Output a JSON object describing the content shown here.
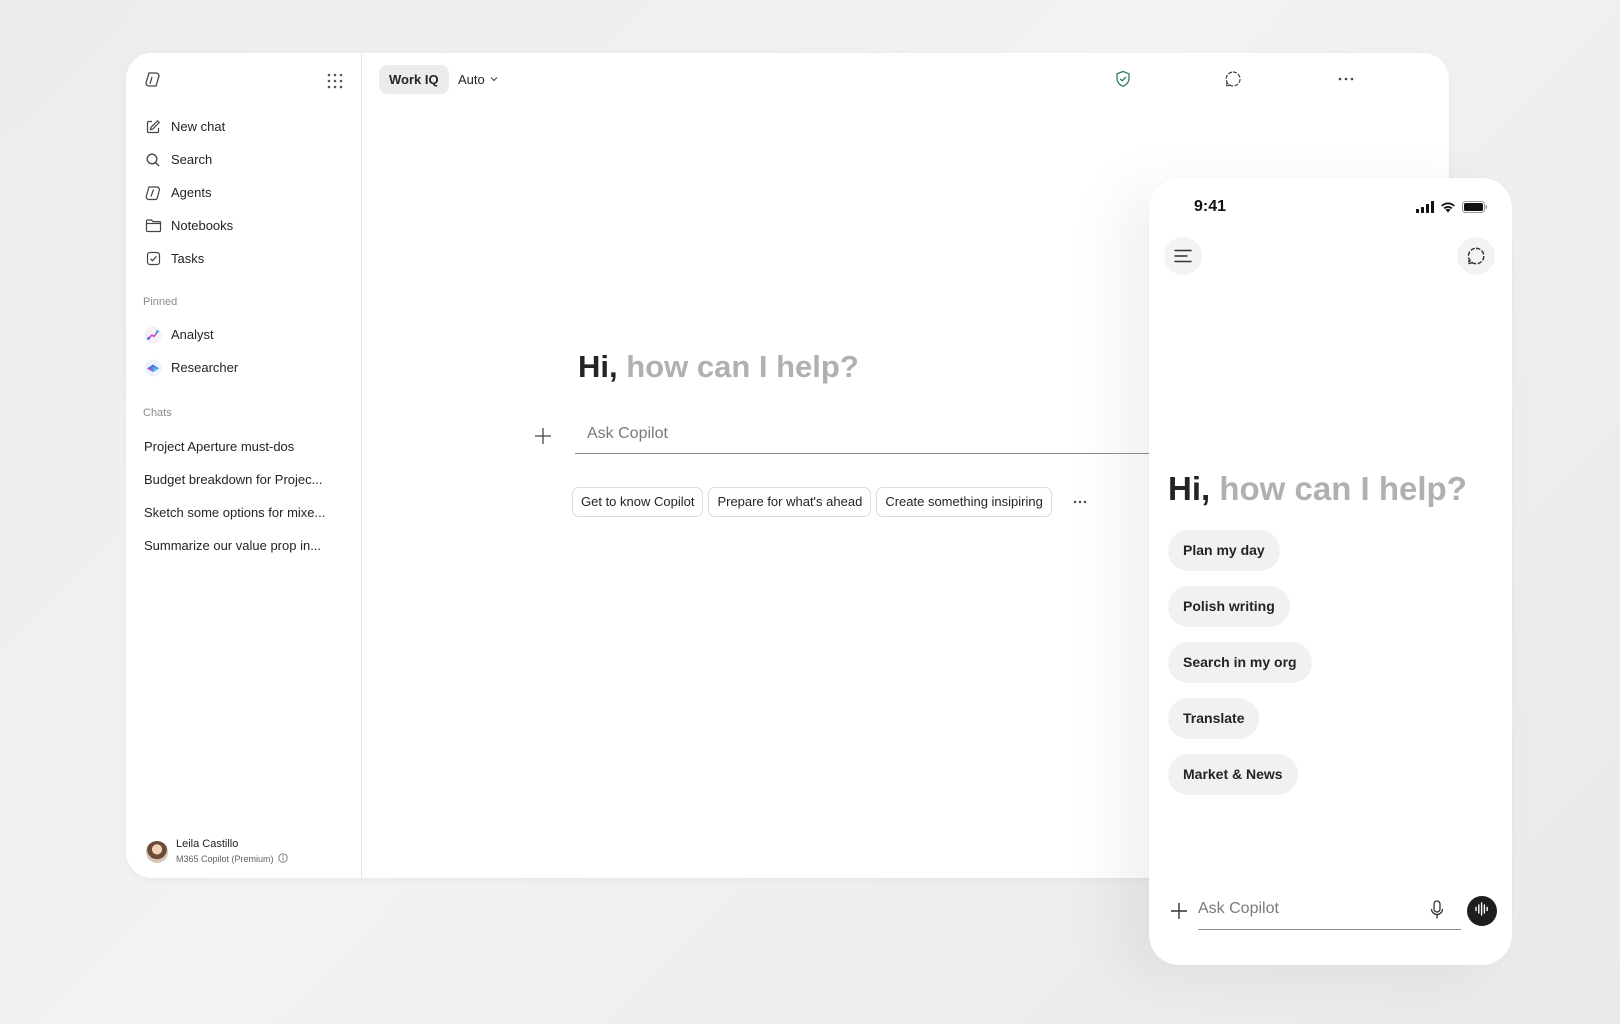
{
  "sidebar": {
    "nav": [
      {
        "label": "New chat",
        "icon": "compose-icon"
      },
      {
        "label": "Search",
        "icon": "search-icon"
      },
      {
        "label": "Agents",
        "icon": "agents-icon"
      },
      {
        "label": "Notebooks",
        "icon": "folder-icon"
      },
      {
        "label": "Tasks",
        "icon": "checkbox-icon"
      }
    ],
    "pinned_label": "Pinned",
    "pinned": [
      {
        "label": "Analyst",
        "icon": "analyst-icon"
      },
      {
        "label": "Researcher",
        "icon": "researcher-icon"
      }
    ],
    "chats_label": "Chats",
    "chats": [
      "Project Aperture must-dos",
      "Budget breakdown for Projec...",
      "Sketch some options for mixe...",
      "Summarize our value prop in..."
    ],
    "user": {
      "name": "Leila Castillo",
      "plan": "M365 Copilot (Premium)"
    }
  },
  "topbar": {
    "workiq_label": "Work IQ",
    "model_label": "Auto",
    "icons": [
      "shield-check-icon",
      "new-chat-bubble-icon",
      "more-icon"
    ]
  },
  "main": {
    "greeting_hi": "Hi,",
    "greeting_rest": "how can I help?",
    "input_placeholder": "Ask Copilot",
    "chips": [
      "Get to know Copilot",
      "Prepare for what's ahead",
      "Create something insipiring"
    ]
  },
  "phone": {
    "time": "9:41",
    "greeting_hi": "Hi,",
    "greeting_rest": "how can I help?",
    "suggestions": [
      "Plan my day",
      "Polish writing",
      "Search in my org",
      "Translate",
      "Market & News"
    ],
    "input_placeholder": "Ask Copilot"
  },
  "colors": {
    "accent_shield": "#2e7d5b",
    "muted_greeting": "#b0b0b0",
    "chip_background": "#f1f1f1"
  }
}
